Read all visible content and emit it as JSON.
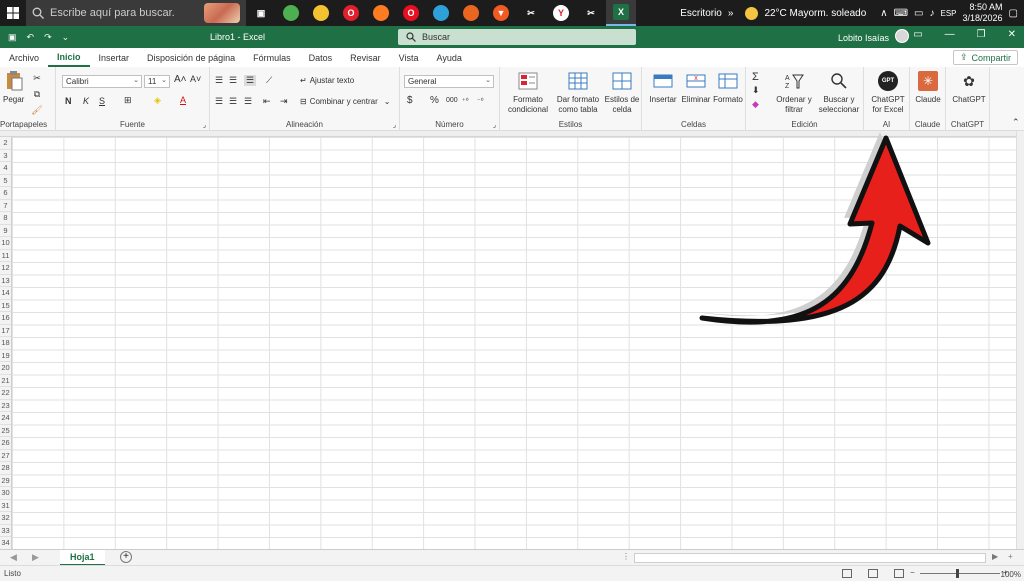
{
  "taskbar": {
    "search_placeholder": "Escribe aquí para buscar.",
    "desktop_label": "Escritorio",
    "weather": "22°C  Mayorm. soleado",
    "lang": "ESP",
    "time": "8:50 AM",
    "date": "3/18/2026",
    "apps": [
      {
        "name": "task-view",
        "color": "#1c1c1c",
        "glyph": "▣"
      },
      {
        "name": "chrome",
        "color": "#4caf50",
        "glyph": ""
      },
      {
        "name": "file-explorer",
        "color": "#f2c230",
        "glyph": ""
      },
      {
        "name": "opera-gx",
        "color": "#e0202c",
        "glyph": "O"
      },
      {
        "name": "firefox",
        "color": "#ff7b21",
        "glyph": ""
      },
      {
        "name": "opera",
        "color": "#e81020",
        "glyph": "O"
      },
      {
        "name": "edge",
        "color": "#2ea1d8",
        "glyph": ""
      },
      {
        "name": "firefox-alt",
        "color": "#e96520",
        "glyph": ""
      },
      {
        "name": "brave",
        "color": "#f15a22",
        "glyph": "▼"
      },
      {
        "name": "capcut",
        "color": "#1c1c1c",
        "glyph": "✂"
      },
      {
        "name": "yandex",
        "color": "#ffffff",
        "glyph": "Y"
      },
      {
        "name": "capcut-alt",
        "color": "#1c1c1c",
        "glyph": "✂"
      },
      {
        "name": "excel",
        "color": "#1f7145",
        "glyph": "X"
      }
    ]
  },
  "titlebar": {
    "doc_title": "Libro1  -  Excel",
    "search_label": "Buscar",
    "user_name": "Lobito Isaías"
  },
  "menu": {
    "items": [
      "Archivo",
      "Inicio",
      "Insertar",
      "Disposición de página",
      "Fórmulas",
      "Datos",
      "Revisar",
      "Vista",
      "Ayuda"
    ],
    "active": "Inicio",
    "share": "Compartir"
  },
  "ribbon": {
    "portapapeles": {
      "label": "Portapapeles",
      "paste": "Pegar"
    },
    "fuente": {
      "label": "Fuente",
      "font": "Calibri",
      "size": "11",
      "bold": "N",
      "italic": "K",
      "underline": "S"
    },
    "alineacion": {
      "label": "Alineación",
      "wrap": "Ajustar texto",
      "merge": "Combinar y centrar"
    },
    "numero": {
      "label": "Número",
      "format": "General",
      "currency": "$",
      "percent": "%",
      "thousands": "000"
    },
    "estilos": {
      "label": "Estilos",
      "cond_line1": "Formato",
      "cond_line2": "condicional",
      "table_line1": "Dar formato",
      "table_line2": "como tabla",
      "cell_line1": "Estilos de",
      "cell_line2": "celda"
    },
    "celdas": {
      "label": "Celdas",
      "insert": "Insertar",
      "delete": "Eliminar",
      "format": "Formato"
    },
    "edicion": {
      "label": "Edición",
      "sort_line1": "Ordenar y",
      "sort_line2": "filtrar",
      "find_line1": "Buscar y",
      "find_line2": "seleccionar"
    },
    "ai": {
      "label": "AI",
      "gpt_line1": "ChatGPT",
      "gpt_line2": "for Excel",
      "gpt_icon": "GPT"
    },
    "claude": {
      "label": "Claude",
      "btn": "Claude"
    },
    "chatgpt": {
      "label": "ChatGPT",
      "btn": "ChatGPT"
    }
  },
  "rows": [
    "2",
    "3",
    "4",
    "5",
    "6",
    "7",
    "8",
    "9",
    "10",
    "11",
    "12",
    "13",
    "14",
    "15",
    "16",
    "17",
    "18",
    "19",
    "20",
    "21",
    "22",
    "23",
    "24",
    "25",
    "26",
    "27",
    "28",
    "29",
    "30",
    "31",
    "32",
    "33",
    "34"
  ],
  "sheet": {
    "tab": "Hoja1",
    "add": "+"
  },
  "status": {
    "ready": "Listo",
    "zoom": "100%"
  },
  "colors": {
    "excel_green": "#1f7145",
    "arrow_red": "#e8201c"
  }
}
